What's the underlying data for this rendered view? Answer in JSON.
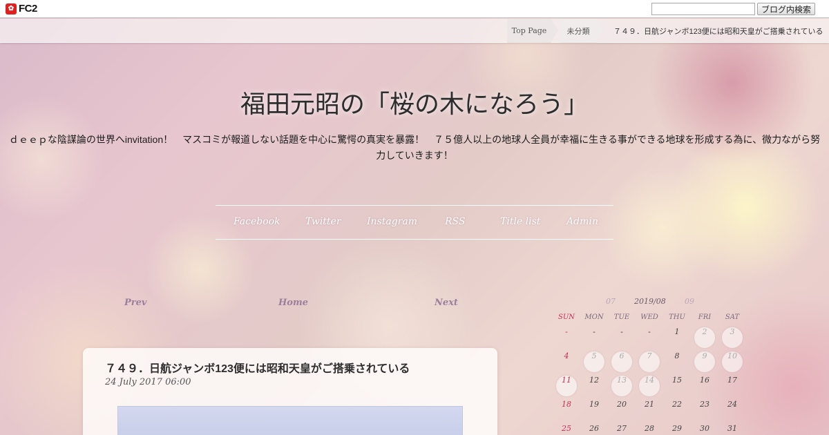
{
  "topbar": {
    "logo_mark": "FC2",
    "logo_text": "FC2",
    "search_placeholder": "",
    "search_button": "ブログ内検索"
  },
  "breadcrumb": {
    "top": "Top Page",
    "category": "未分類",
    "current": "７４９．日航ジャンボ123便には昭和天皇がご搭乗されている"
  },
  "header": {
    "title": "福田元昭の「桜の木になろう」",
    "description_line1": "ｄｅｅｐな陰謀論の世界へinvitation！　マスコミが報道しない話題を中心に驚愕の真実を暴露！　７５億人以上の地球人全員が幸福に生きる事ができる地球を形成する為に、微力ながら努",
    "description_line2": "力していきます！"
  },
  "nav": [
    "Facebook",
    "Twitter",
    "Instagram",
    "RSS",
    "Title list",
    "Admin"
  ],
  "pager": {
    "prev": "Prev",
    "home": "Home",
    "next": "Next"
  },
  "article": {
    "title": "７４９．日航ジャンボ123便には昭和天皇がご搭乗されている",
    "date": "24 July 2017 06:00"
  },
  "calendar": {
    "prev_month": "07",
    "current": "2019/08",
    "next_month": "09",
    "weekdays": [
      "SUN",
      "MON",
      "TUE",
      "WED",
      "THU",
      "FRI",
      "SAT"
    ],
    "weeks": [
      [
        "-",
        "-",
        "-",
        "-",
        "1",
        "2",
        "3"
      ],
      [
        "4",
        "5",
        "6",
        "7",
        "8",
        "9",
        "10"
      ],
      [
        "11",
        "12",
        "13",
        "14",
        "15",
        "16",
        "17"
      ],
      [
        "18",
        "19",
        "20",
        "21",
        "22",
        "23",
        "24"
      ],
      [
        "25",
        "26",
        "27",
        "28",
        "29",
        "30",
        "31"
      ]
    ],
    "highlighted_days": [
      "2",
      "3",
      "5",
      "6",
      "7",
      "9",
      "10",
      "11",
      "13",
      "14"
    ],
    "colors": {
      "sunday": "#c0305a",
      "accent": "#9b7f9b"
    }
  }
}
